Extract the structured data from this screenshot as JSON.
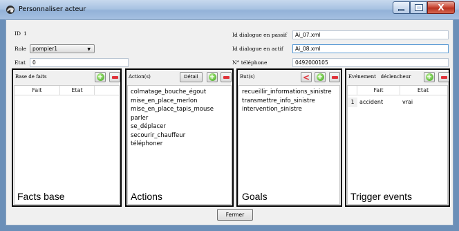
{
  "window": {
    "title": "Personnaliser acteur",
    "minimize_symbol": "",
    "maximize_symbol": "",
    "close_symbol": "X"
  },
  "form": {
    "id_label": "ID",
    "id_value": "1",
    "role_label": "Role",
    "role_value": "pompier1",
    "etat_label": "Etat",
    "etat_value": "0",
    "dialog_passive_label": "Id dialogue en passif",
    "dialog_passive_value": "Ai_07.xml",
    "dialog_active_label": "Id dialogue en actif",
    "dialog_active_value": "Ai_08.xml",
    "phone_label": "N° téléphone",
    "phone_value": "0492000105"
  },
  "facts_panel": {
    "title": "Base de faits",
    "columns": [
      "Fait",
      "Etat"
    ],
    "caption": "Facts base"
  },
  "actions_panel": {
    "title": "Action(s)",
    "detail_button": "Détail",
    "items": [
      "colmatage_bouche_égout",
      "mise_en_place_merlon",
      "mise_en_place_tapis_mouse",
      "parler",
      "se_déplacer",
      "secourir_chauffeur",
      "téléphoner"
    ],
    "caption": "Actions"
  },
  "goals_panel": {
    "title": "But(s)",
    "items": [
      "recueillir_informations_sinistre",
      "transmettre_info_sinistre",
      "intervention_sinistre"
    ],
    "caption": "Goals"
  },
  "triggers_panel": {
    "title": "Evénement   déclencheur",
    "columns": [
      "Fait",
      "Etat"
    ],
    "rows": [
      {
        "index": "1",
        "fait": "accident",
        "etat": "vrai"
      }
    ],
    "caption": "Trigger events"
  },
  "footer": {
    "close_button": "Fermer"
  },
  "colors": {
    "titlebar": "#a9c3e2",
    "close_button": "#c8412f",
    "add_icon": "#3da51d",
    "remove_icon": "#e0323a"
  }
}
